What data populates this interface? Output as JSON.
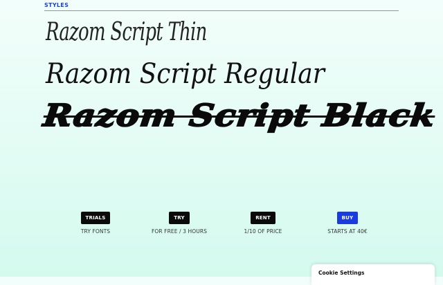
{
  "section": {
    "label": "STYLES"
  },
  "samples": [
    {
      "name": "Razom Script Thin"
    },
    {
      "name": "Razom Script Regular"
    },
    {
      "name": "Razom Script Black"
    }
  ],
  "options": [
    {
      "button": "TRIALS",
      "description": "TRY FONTS",
      "accent": "#0a0a0a"
    },
    {
      "button": "TRY",
      "description": "FOR FREE / 3 HOURS",
      "accent": "#0a0a0a"
    },
    {
      "button": "RENT",
      "description": "1/10 OF PRICE",
      "accent": "#0a0a0a"
    },
    {
      "button": "BUY",
      "description": "STARTS AT 40€",
      "accent": "#1a3be0"
    }
  ],
  "cookie": {
    "title": "Cookie Settings"
  },
  "colors": {
    "styles_label": "#1f3fd6",
    "background_top": "#f3fefb",
    "background_bottom": "#d4faee"
  }
}
